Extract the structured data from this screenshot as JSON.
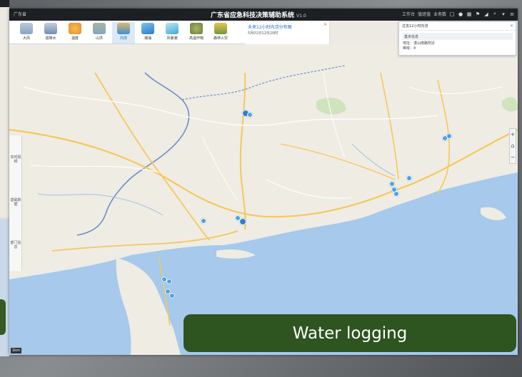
{
  "window": {
    "province_label": "广东省",
    "title": "广东省应急科技决策辅助系统",
    "version": "V1.0"
  },
  "header_links": [
    "工作台",
    "值班值",
    "业务数"
  ],
  "header_icons": [
    "square-icon",
    "lock-icon",
    "grid-icon",
    "flag-icon",
    "signal-icon",
    "search-icon",
    "pin-icon",
    "menu-icon"
  ],
  "toolbar": {
    "tools": [
      {
        "label": "大风",
        "icon": "wind-icon",
        "color": "#8aa4c4"
      },
      {
        "label": "强降水",
        "icon": "rain-icon",
        "color": "#6f8fb5"
      },
      {
        "label": "温度",
        "icon": "temperature-icon",
        "color": "#e88a3a"
      },
      {
        "label": "山洪",
        "icon": "mountain-flood-icon",
        "color": "#7fa6c9"
      },
      {
        "label": "内涝",
        "icon": "waterlogging-icon",
        "color": "#3d8fd8"
      },
      {
        "label": "潮涌",
        "icon": "wave-icon",
        "color": "#2b7cc9"
      },
      {
        "label": "风暴潮",
        "icon": "storm-surge-icon",
        "color": "#3fa9d9"
      },
      {
        "label": "高温作物",
        "icon": "crop-icon",
        "color": "#6b7f3a"
      },
      {
        "label": "森林火灾",
        "icon": "forest-fire-icon",
        "color": "#c9a23a"
      }
    ],
    "active_index": 4
  },
  "info_panel": {
    "title": "未来12小时内涝分布图",
    "time": "5月01日12日20时",
    "close": "×"
  },
  "popup": {
    "header": "过去12小时内涝",
    "close": "×",
    "section": "基本信息",
    "lines": [
      "地址：湛山南路附近",
      "等级：4"
    ]
  },
  "side_panel": {
    "items": [
      "实时视频",
      "基础数据",
      "部门信息"
    ]
  },
  "zoom": {
    "in": "+",
    "out": "−",
    "reset": "⌂"
  },
  "scale": "1km",
  "caption": "Water logging",
  "colors": {
    "land": "#efece4",
    "sea": "#a6c9ec",
    "road_major": "#f5c85b",
    "road_minor": "#ffffff",
    "boundary": "#5f86c2",
    "marker": "#4aa3e8",
    "caption_bg": "#2e5420"
  }
}
